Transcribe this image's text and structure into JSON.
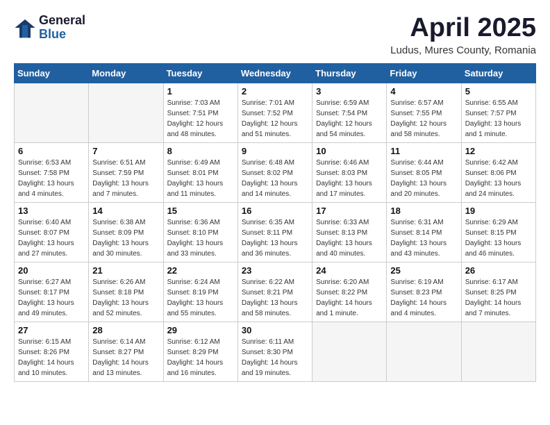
{
  "header": {
    "logo_general": "General",
    "logo_blue": "Blue",
    "month_title": "April 2025",
    "location": "Ludus, Mures County, Romania"
  },
  "days_of_week": [
    "Sunday",
    "Monday",
    "Tuesday",
    "Wednesday",
    "Thursday",
    "Friday",
    "Saturday"
  ],
  "weeks": [
    [
      {
        "day": "",
        "info": ""
      },
      {
        "day": "",
        "info": ""
      },
      {
        "day": "1",
        "info": "Sunrise: 7:03 AM\nSunset: 7:51 PM\nDaylight: 12 hours\nand 48 minutes."
      },
      {
        "day": "2",
        "info": "Sunrise: 7:01 AM\nSunset: 7:52 PM\nDaylight: 12 hours\nand 51 minutes."
      },
      {
        "day": "3",
        "info": "Sunrise: 6:59 AM\nSunset: 7:54 PM\nDaylight: 12 hours\nand 54 minutes."
      },
      {
        "day": "4",
        "info": "Sunrise: 6:57 AM\nSunset: 7:55 PM\nDaylight: 12 hours\nand 58 minutes."
      },
      {
        "day": "5",
        "info": "Sunrise: 6:55 AM\nSunset: 7:57 PM\nDaylight: 13 hours\nand 1 minute."
      }
    ],
    [
      {
        "day": "6",
        "info": "Sunrise: 6:53 AM\nSunset: 7:58 PM\nDaylight: 13 hours\nand 4 minutes."
      },
      {
        "day": "7",
        "info": "Sunrise: 6:51 AM\nSunset: 7:59 PM\nDaylight: 13 hours\nand 7 minutes."
      },
      {
        "day": "8",
        "info": "Sunrise: 6:49 AM\nSunset: 8:01 PM\nDaylight: 13 hours\nand 11 minutes."
      },
      {
        "day": "9",
        "info": "Sunrise: 6:48 AM\nSunset: 8:02 PM\nDaylight: 13 hours\nand 14 minutes."
      },
      {
        "day": "10",
        "info": "Sunrise: 6:46 AM\nSunset: 8:03 PM\nDaylight: 13 hours\nand 17 minutes."
      },
      {
        "day": "11",
        "info": "Sunrise: 6:44 AM\nSunset: 8:05 PM\nDaylight: 13 hours\nand 20 minutes."
      },
      {
        "day": "12",
        "info": "Sunrise: 6:42 AM\nSunset: 8:06 PM\nDaylight: 13 hours\nand 24 minutes."
      }
    ],
    [
      {
        "day": "13",
        "info": "Sunrise: 6:40 AM\nSunset: 8:07 PM\nDaylight: 13 hours\nand 27 minutes."
      },
      {
        "day": "14",
        "info": "Sunrise: 6:38 AM\nSunset: 8:09 PM\nDaylight: 13 hours\nand 30 minutes."
      },
      {
        "day": "15",
        "info": "Sunrise: 6:36 AM\nSunset: 8:10 PM\nDaylight: 13 hours\nand 33 minutes."
      },
      {
        "day": "16",
        "info": "Sunrise: 6:35 AM\nSunset: 8:11 PM\nDaylight: 13 hours\nand 36 minutes."
      },
      {
        "day": "17",
        "info": "Sunrise: 6:33 AM\nSunset: 8:13 PM\nDaylight: 13 hours\nand 40 minutes."
      },
      {
        "day": "18",
        "info": "Sunrise: 6:31 AM\nSunset: 8:14 PM\nDaylight: 13 hours\nand 43 minutes."
      },
      {
        "day": "19",
        "info": "Sunrise: 6:29 AM\nSunset: 8:15 PM\nDaylight: 13 hours\nand 46 minutes."
      }
    ],
    [
      {
        "day": "20",
        "info": "Sunrise: 6:27 AM\nSunset: 8:17 PM\nDaylight: 13 hours\nand 49 minutes."
      },
      {
        "day": "21",
        "info": "Sunrise: 6:26 AM\nSunset: 8:18 PM\nDaylight: 13 hours\nand 52 minutes."
      },
      {
        "day": "22",
        "info": "Sunrise: 6:24 AM\nSunset: 8:19 PM\nDaylight: 13 hours\nand 55 minutes."
      },
      {
        "day": "23",
        "info": "Sunrise: 6:22 AM\nSunset: 8:21 PM\nDaylight: 13 hours\nand 58 minutes."
      },
      {
        "day": "24",
        "info": "Sunrise: 6:20 AM\nSunset: 8:22 PM\nDaylight: 14 hours\nand 1 minute."
      },
      {
        "day": "25",
        "info": "Sunrise: 6:19 AM\nSunset: 8:23 PM\nDaylight: 14 hours\nand 4 minutes."
      },
      {
        "day": "26",
        "info": "Sunrise: 6:17 AM\nSunset: 8:25 PM\nDaylight: 14 hours\nand 7 minutes."
      }
    ],
    [
      {
        "day": "27",
        "info": "Sunrise: 6:15 AM\nSunset: 8:26 PM\nDaylight: 14 hours\nand 10 minutes."
      },
      {
        "day": "28",
        "info": "Sunrise: 6:14 AM\nSunset: 8:27 PM\nDaylight: 14 hours\nand 13 minutes."
      },
      {
        "day": "29",
        "info": "Sunrise: 6:12 AM\nSunset: 8:29 PM\nDaylight: 14 hours\nand 16 minutes."
      },
      {
        "day": "30",
        "info": "Sunrise: 6:11 AM\nSunset: 8:30 PM\nDaylight: 14 hours\nand 19 minutes."
      },
      {
        "day": "",
        "info": ""
      },
      {
        "day": "",
        "info": ""
      },
      {
        "day": "",
        "info": ""
      }
    ]
  ]
}
